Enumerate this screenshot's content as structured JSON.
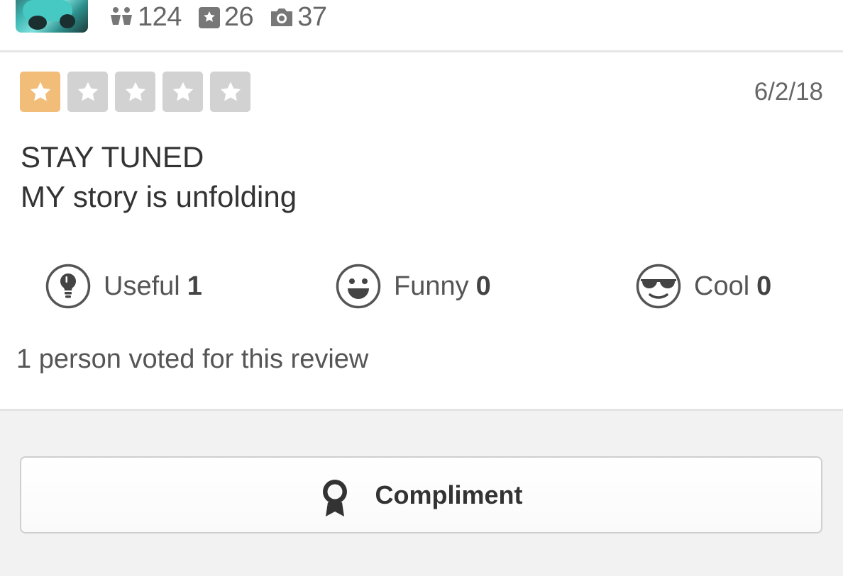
{
  "user": {
    "friends_count": "124",
    "reviews_count": "26",
    "photos_count": "37"
  },
  "review": {
    "rating": 1,
    "max_rating": 5,
    "date": "6/2/18",
    "lines": [
      "STAY TUNED",
      "MY story is unfolding"
    ]
  },
  "votes": {
    "useful": {
      "label": "Useful",
      "count": "1"
    },
    "funny": {
      "label": "Funny",
      "count": "0"
    },
    "cool": {
      "label": "Cool",
      "count": "0"
    },
    "summary": "1 person voted for this review"
  },
  "actions": {
    "compliment_label": "Compliment"
  },
  "icons": {
    "friends": "friends-icon",
    "reviews": "star-box-icon",
    "photos": "camera-icon",
    "useful": "lightbulb-icon",
    "funny": "smiley-icon",
    "cool": "sunglasses-icon",
    "compliment": "award-ribbon-icon"
  },
  "colors": {
    "star_active": "#f2bd79",
    "star_inactive": "#d2d2d2"
  }
}
